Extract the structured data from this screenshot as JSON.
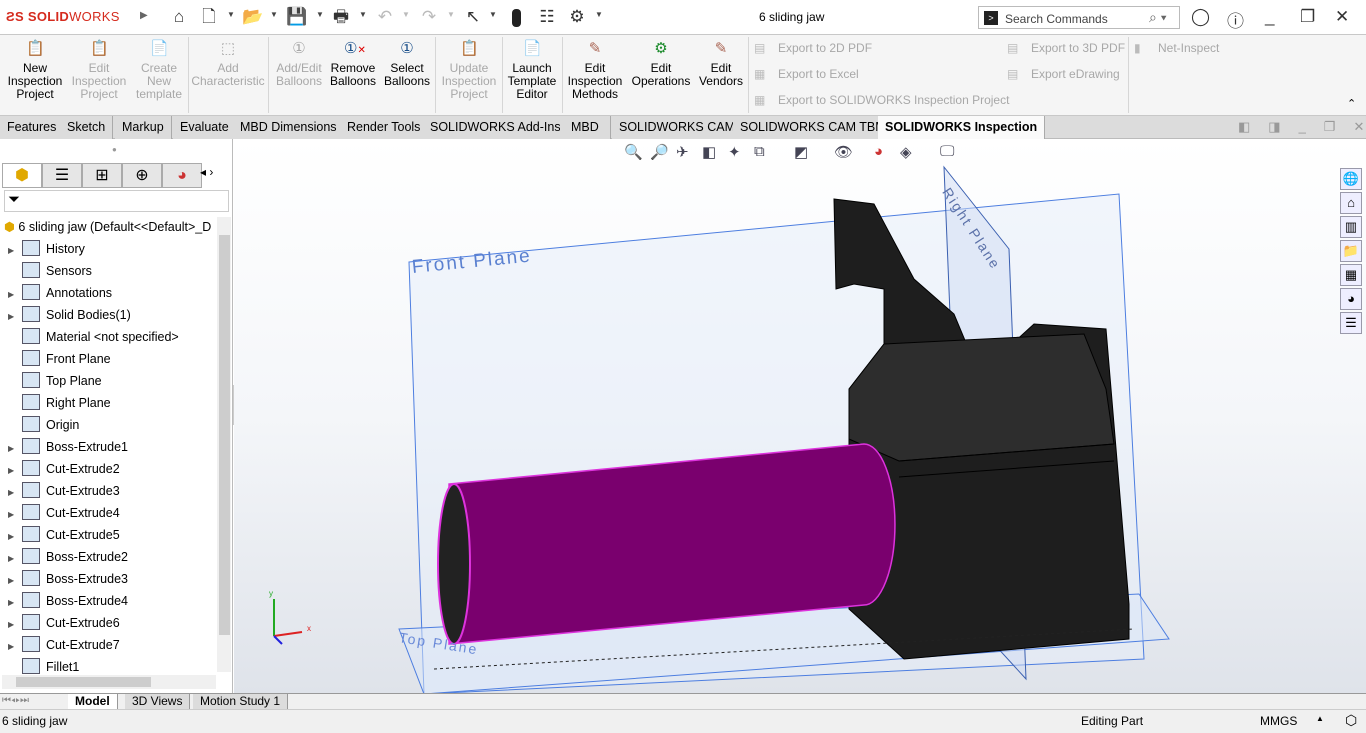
{
  "app": {
    "logo": "SOLIDWORKS",
    "document_title": "6 sliding jaw"
  },
  "search": {
    "placeholder": "Search Commands"
  },
  "ribbon": {
    "buttons": [
      {
        "label": "New Inspection Project",
        "enabled": true
      },
      {
        "label": "Edit Inspection Project",
        "enabled": false
      },
      {
        "label": "Create New template",
        "enabled": false
      },
      {
        "label": "Add Characteristic",
        "enabled": false
      },
      {
        "label": "Add/Edit Balloons",
        "enabled": false
      },
      {
        "label": "Remove Balloons",
        "enabled": true
      },
      {
        "label": "Select Balloons",
        "enabled": true
      },
      {
        "label": "Update Inspection Project",
        "enabled": false
      },
      {
        "label": "Launch Template Editor",
        "enabled": true
      },
      {
        "label": "Edit Inspection Methods",
        "enabled": true
      },
      {
        "label": "Edit Operations",
        "enabled": true
      },
      {
        "label": "Edit Vendors",
        "enabled": true
      }
    ],
    "small": [
      "Export to 2D PDF",
      "Export to Excel",
      "Export to SOLIDWORKS Inspection Project",
      "Export to 3D PDF",
      "Export eDrawing",
      "Net-Inspect"
    ]
  },
  "tabs": [
    "Features",
    "Sketch",
    "Markup",
    "Evaluate",
    "MBD Dimensions",
    "Render Tools",
    "SOLIDWORKS Add-Ins",
    "MBD",
    "SOLIDWORKS CAM",
    "SOLIDWORKS CAM TBM",
    "SOLIDWORKS Inspection"
  ],
  "active_tab": "SOLIDWORKS Inspection",
  "tree": {
    "root": "6 sliding jaw  (Default<<Default>_D",
    "items": [
      "History",
      "Sensors",
      "Annotations",
      "Solid Bodies(1)",
      "Material <not specified>",
      "Front Plane",
      "Top Plane",
      "Right Plane",
      "Origin",
      "Boss-Extrude1",
      "Cut-Extrude2",
      "Cut-Extrude3",
      "Cut-Extrude4",
      "Cut-Extrude5",
      "Boss-Extrude2",
      "Boss-Extrude3",
      "Boss-Extrude4",
      "Cut-Extrude6",
      "Cut-Extrude7",
      "Fillet1"
    ]
  },
  "viewport": {
    "planes": {
      "front": "Front Plane",
      "top": "Top Plane",
      "right": "Right Plane"
    },
    "highlight_color": "#cc00cc",
    "axes": {
      "x": "x",
      "y": "y"
    }
  },
  "bottom_tabs": [
    "Model",
    "3D Views",
    "Motion Study 1"
  ],
  "status": {
    "left": "6 sliding jaw",
    "mode": "Editing Part",
    "units": "MMGS"
  }
}
